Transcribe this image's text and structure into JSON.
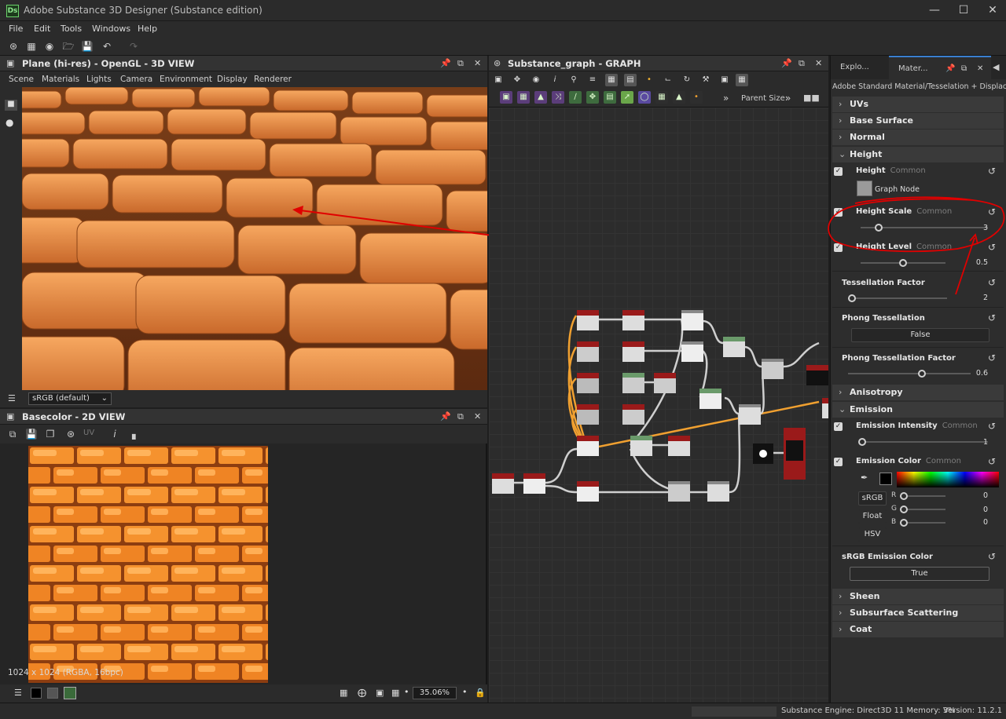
{
  "app": {
    "title": "Adobe Substance 3D Designer (Substance edition)",
    "logo": "Ds"
  },
  "menu": [
    "File",
    "Edit",
    "Tools",
    "Windows",
    "Help"
  ],
  "view3d": {
    "title": "Plane (hi-res) - OpenGL - 3D VIEW",
    "menu": [
      "Scene",
      "Materials",
      "Lights",
      "Camera",
      "Environment",
      "Display",
      "Renderer"
    ],
    "colorspace": "sRGB (default)"
  },
  "view2d": {
    "title": "Basecolor - 2D VIEW",
    "info": "1024 x 1024 (RGBA, 16bpc)",
    "uv_label": "UV",
    "zoom": "35.06%"
  },
  "graph": {
    "title": "Substance_graph - GRAPH",
    "parent_size_label": "Parent Size:"
  },
  "properties": {
    "tabs": [
      "Explo...",
      "Mater..."
    ],
    "path": "Adobe Standard Material/Tesselation + Displacement",
    "sections": {
      "uvs": "UVs",
      "base_surface": "Base Surface",
      "normal": "Normal",
      "height": "Height",
      "anisotropy": "Anisotropy",
      "emission": "Emission",
      "sheen": "Sheen",
      "sss": "Subsurface Scattering",
      "coat": "Coat"
    },
    "common": "Common",
    "height": {
      "label": "Height",
      "graph_node": "Graph Node"
    },
    "height_scale": {
      "label": "Height Scale",
      "value": "3",
      "fraction": 0.14
    },
    "height_level": {
      "label": "Height Level",
      "value": "0.5",
      "fraction": 0.5
    },
    "tess_factor": {
      "label": "Tessellation Factor",
      "value": "2",
      "fraction": 0.04
    },
    "phong_tess": {
      "label": "Phong Tessellation",
      "value": "False"
    },
    "phong_factor": {
      "label": "Phong Tessellation Factor",
      "value": "0.6",
      "fraction": 0.6
    },
    "emission_intensity": {
      "label": "Emission Intensity",
      "value": "1",
      "fraction": 0.0
    },
    "emission_color": {
      "label": "Emission Color",
      "modes": [
        "sRGB",
        "Float",
        "HSV"
      ],
      "r_label": "R",
      "g_label": "G",
      "b_label": "B",
      "r": "0",
      "g": "0",
      "b": "0"
    },
    "srgb_emission": {
      "label": "sRGB Emission Color",
      "value": "True"
    }
  },
  "status": {
    "engine": "Substance Engine: Direct3D 11 Memory: 3%",
    "version": "Version: 11.2.1"
  },
  "colors": {
    "accent": "#e0e0e0",
    "annotation": "#e00000",
    "brick": "#ef8a2c",
    "node_header": "#9a1a1a",
    "wire": "#f0a030"
  }
}
